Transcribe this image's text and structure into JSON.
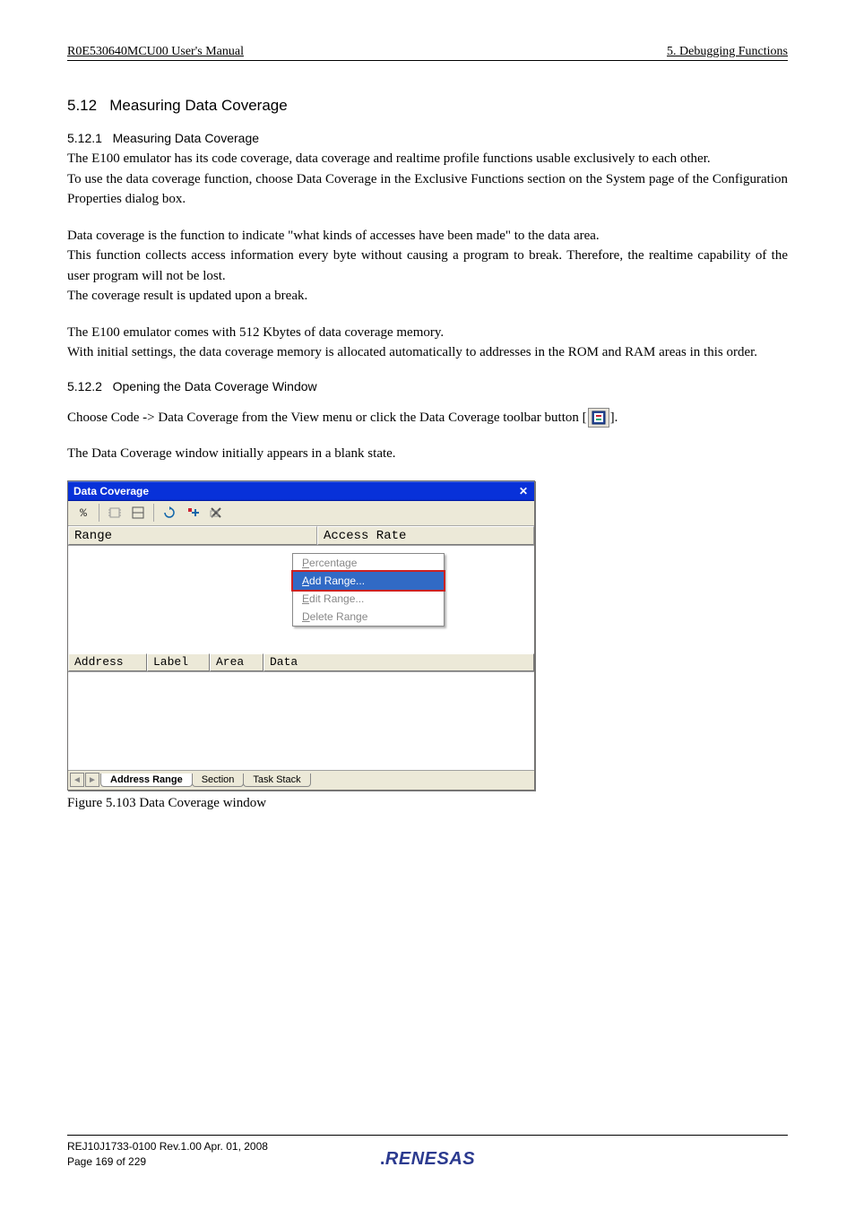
{
  "header": {
    "left": "R0E530640MCU00 User's Manual",
    "right": "5. Debugging Functions"
  },
  "section": {
    "num": "5.12",
    "title": "Measuring Data Coverage",
    "sub1": {
      "num": "5.12.1",
      "title": "Measuring Data Coverage"
    },
    "sub2": {
      "num": "5.12.2",
      "title": "Opening the Data Coverage Window"
    }
  },
  "paragraphs": {
    "p1": "The E100 emulator has its code coverage, data coverage and realtime profile functions usable exclusively to each other.",
    "p2": "To use the data coverage function, choose Data Coverage in the Exclusive Functions section on the System page of the Configuration Properties dialog box.",
    "p3": "Data coverage is the function to indicate \"what kinds of accesses have been made\" to the data area.",
    "p4": "This function collects access information every byte without causing a program to break. Therefore, the realtime capability of the user program will not be lost.",
    "p5": "The coverage result is updated upon a break.",
    "p6": "The E100 emulator comes with 512 Kbytes of data coverage memory.",
    "p7": "With initial settings, the data coverage memory is allocated automatically to addresses in the ROM and RAM areas in this order.",
    "p8a": "Choose Code -> Data Coverage from the View menu or click the Data Coverage toolbar button [",
    "p8b": "].",
    "p9": "The Data Coverage window initially appears in a blank state."
  },
  "window": {
    "title": "Data Coverage",
    "toolbar": {
      "percent_label": "%",
      "icons": [
        "hardware-icon",
        "layout-icon",
        "refresh-icon",
        "insert-icon",
        "clear-icon"
      ]
    },
    "upper_columns": {
      "c1": "Range",
      "c2": "Access Rate"
    },
    "context_menu": {
      "items": [
        {
          "label": "Percentage",
          "key": "P",
          "enabled": false,
          "selected": false
        },
        {
          "label": "Add Range...",
          "key": "A",
          "enabled": true,
          "selected": true
        },
        {
          "label": "Edit Range...",
          "key": "E",
          "enabled": false,
          "selected": false
        },
        {
          "label": "Delete Range",
          "key": "D",
          "enabled": false,
          "selected": false
        }
      ]
    },
    "lower_columns": {
      "c1": "Address",
      "c2": "Label",
      "c3": "Area",
      "c4": "Data"
    },
    "tabs": {
      "t1": "Address Range",
      "t2": "Section",
      "t3": "Task Stack"
    }
  },
  "figure_caption": "Figure 5.103 Data Coverage window",
  "footer": {
    "line1": "REJ10J1733-0100   Rev.1.00   Apr. 01, 2008",
    "line2": "Page 169 of 229",
    "logo": "RENESAS"
  }
}
